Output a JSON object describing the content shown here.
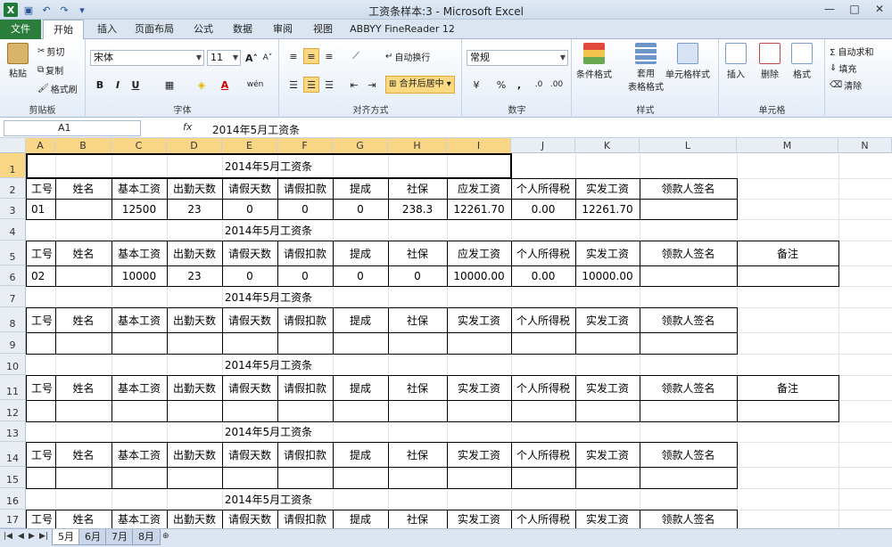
{
  "window": {
    "title": "工资条样本:3 - Microsoft Excel",
    "app_icon": "X",
    "controls": [
      "—",
      "□",
      "✕"
    ]
  },
  "tabs": {
    "file": "文件",
    "items": [
      "开始",
      "插入",
      "页面布局",
      "公式",
      "数据",
      "审阅",
      "视图",
      "ABBYY FineReader 12"
    ]
  },
  "ribbon": {
    "clipboard": {
      "paste": "粘贴",
      "cut": "剪切",
      "copy": "复制",
      "format_painter": "格式刷",
      "label": "剪贴板"
    },
    "font": {
      "name": "宋体",
      "size": "11",
      "bold": "B",
      "italic": "I",
      "underline": "U",
      "grow": "A",
      "shrink": "A",
      "label": "字体",
      "phonetic": "wén"
    },
    "alignment": {
      "wrap": "自动换行",
      "merge": "合并后居中",
      "label": "对齐方式"
    },
    "number": {
      "format": "常规",
      "percent": "%",
      "comma": ",",
      "label": "数字"
    },
    "styles": {
      "conditional": "条件格式",
      "table": "套用\n表格格式",
      "table_line1": "套用",
      "table_line2": "表格格式",
      "cell_styles": "单元格样式",
      "label": "样式"
    },
    "cells": {
      "insert": "插入",
      "delete": "删除",
      "format": "格式",
      "label": "单元格"
    },
    "editing": {
      "autosum": "Σ 自动求和",
      "fill": "填充",
      "clear": "清除"
    }
  },
  "formula_bar": {
    "name_box": "A1",
    "fx": "fx",
    "value": "2014年5月工资条"
  },
  "columns": [
    "A",
    "B",
    "C",
    "D",
    "E",
    "F",
    "G",
    "H",
    "I",
    "J",
    "K",
    "L",
    "M",
    "N"
  ],
  "rows": [
    "1",
    "2",
    "3",
    "4",
    "5",
    "6",
    "7",
    "8",
    "9",
    "10",
    "11",
    "12",
    "13",
    "14",
    "15",
    "16",
    "17"
  ],
  "sheet": {
    "title": "2014年5月工资条",
    "header1": [
      "工号",
      "姓名",
      "基本工资",
      "出勤天数",
      "请假天数",
      "请假扣款",
      "提成",
      "社保",
      "应发工资",
      "个人所得税",
      "实发工资",
      "领款人签名"
    ],
    "header2": [
      "工号",
      "姓名",
      "基本工资",
      "出勤天数",
      "请假天数",
      "请假扣款",
      "提成",
      "社保",
      "实发工资",
      "个人所得税",
      "实发工资",
      "领款人签名"
    ],
    "remark": "备注",
    "row3": [
      "01",
      "",
      "12500",
      "23",
      "0",
      "0",
      "0",
      "238.3",
      "12261.70",
      "0.00",
      "12261.70",
      ""
    ],
    "row6": [
      "02",
      "",
      "10000",
      "23",
      "0",
      "0",
      "0",
      "0",
      "10000.00",
      "0.00",
      "10000.00",
      ""
    ]
  },
  "sheet_tabs": [
    "5月",
    "6月",
    "7月",
    "8月"
  ]
}
